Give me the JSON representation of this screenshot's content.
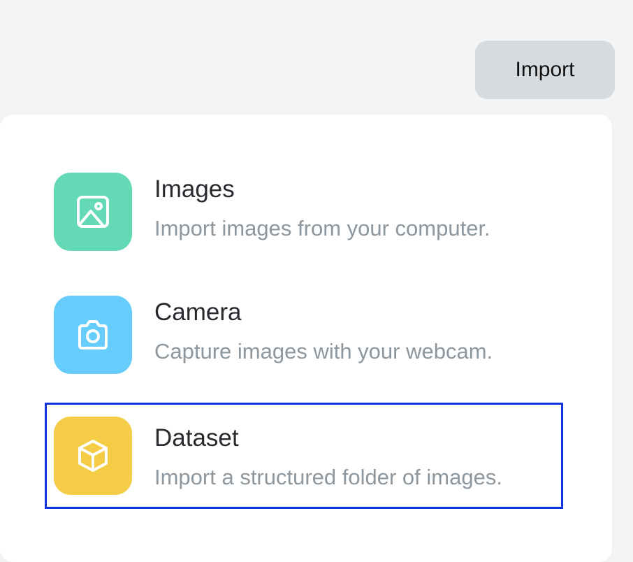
{
  "toolbar": {
    "import_label": "Import"
  },
  "menu": {
    "options": [
      {
        "title": "Images",
        "description": "Import images from your computer.",
        "icon": "image-icon",
        "color": "#63d9b6"
      },
      {
        "title": "Camera",
        "description": "Capture images with your webcam.",
        "icon": "camera-icon",
        "color": "#66ccfc"
      },
      {
        "title": "Dataset",
        "description": "Import a structured folder of images.",
        "icon": "cube-icon",
        "color": "#f4cc46",
        "selected": true
      }
    ]
  },
  "colors": {
    "selection_outline": "#1033e0",
    "import_button_bg": "#d8dbde"
  }
}
